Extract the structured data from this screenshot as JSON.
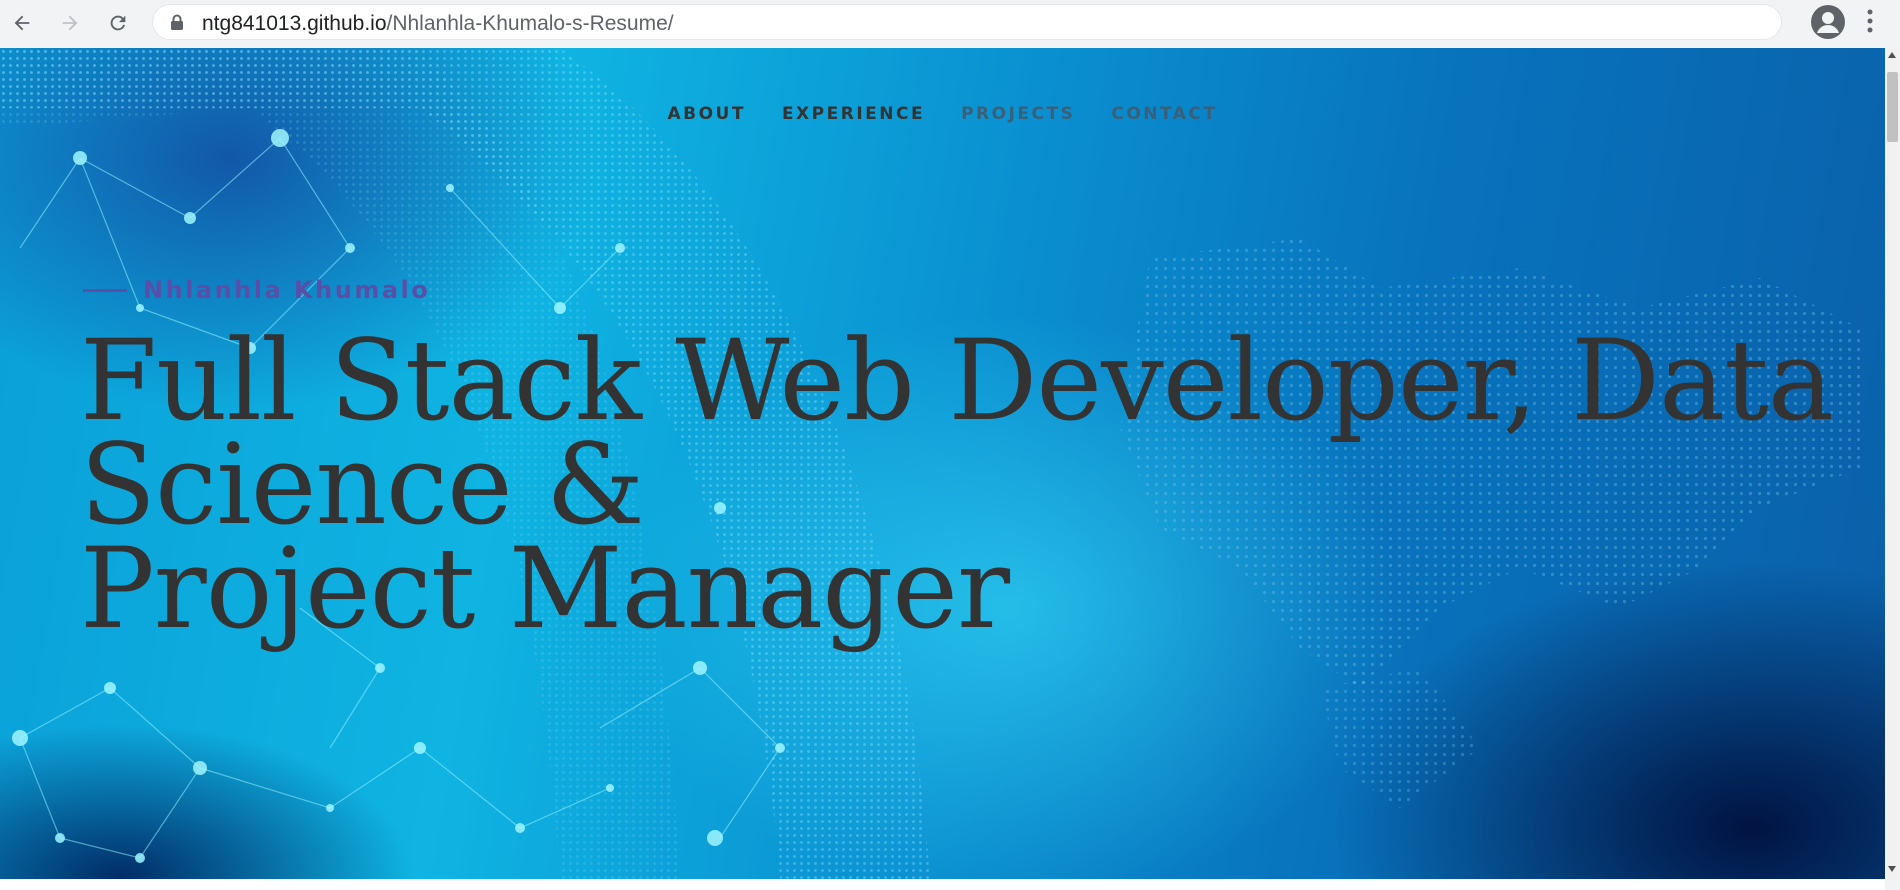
{
  "browser": {
    "url_host": "ntg841013.github.io",
    "url_path": "/Nhlanhla-Khumalo-s-Resume/",
    "icons": [
      "back-icon",
      "forward-icon",
      "reload-icon",
      "lock-icon",
      "star-icon",
      "profile-icon",
      "menu-icon"
    ]
  },
  "nav": {
    "items": [
      "ABOUT",
      "EXPERIENCE",
      "PROJECTS",
      "CONTACT"
    ]
  },
  "hero": {
    "eyebrow_name": "Nhlanhla Khumalo",
    "headline_lines": [
      "Full Stack Web Developer, Data",
      "Science &",
      "Project Manager"
    ]
  },
  "colors": {
    "accent": "#5a4ea8",
    "text": "#333333",
    "hero_bg": "#0a9fd8"
  }
}
